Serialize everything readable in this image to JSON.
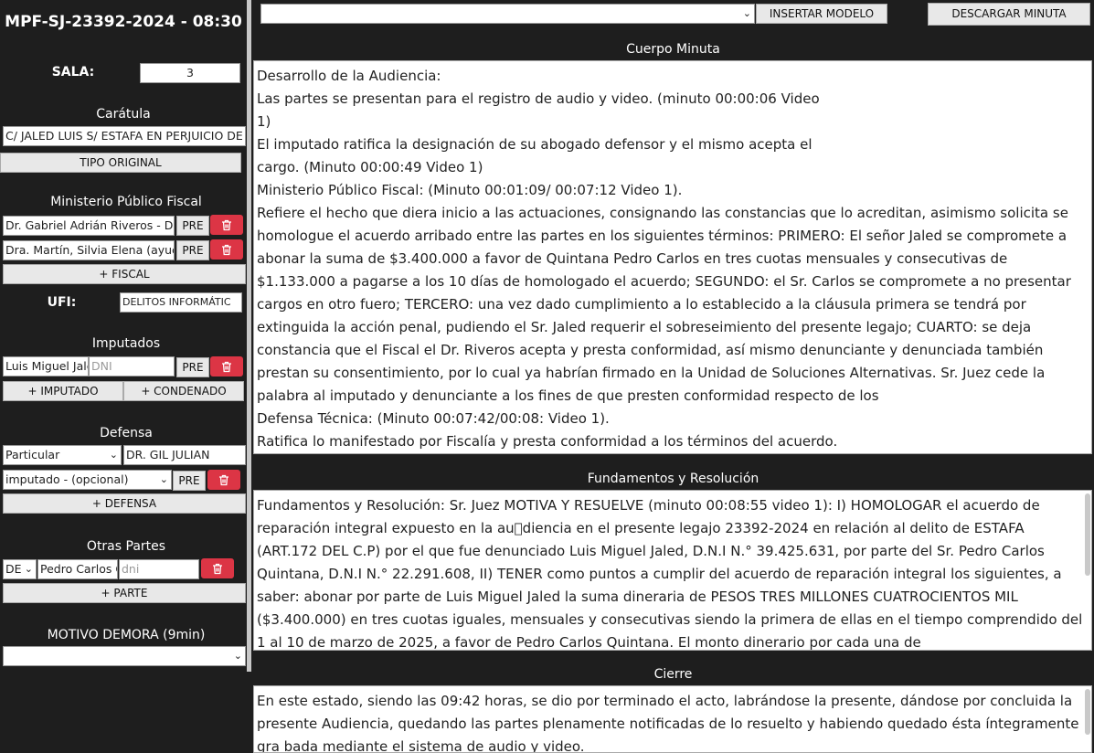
{
  "sidebar": {
    "case_title": "MPF-SJ-23392-2024 - 08:30",
    "sala_label": "SALA:",
    "sala_value": "3",
    "caratula_label": "Carátula",
    "caratula_value": "C/ JALED LUIS S/ ESTAFA EN PERJUICIO DE QU",
    "tipo_original_button": "TIPO ORIGINAL",
    "mpf_label": "Ministerio Público Fiscal",
    "fiscales": [
      {
        "name": "Dr. Gabriel Adrián Riveros - D",
        "pre": "PRE"
      },
      {
        "name": "Dra. Martín, Silvia Elena (ayuc",
        "pre": "PRE"
      }
    ],
    "add_fiscal_button": "+ FISCAL",
    "ufi_label": "UFI:",
    "ufi_value": "DELITOS INFORMÁTIC",
    "imputados_label": "Imputados",
    "imputado": {
      "name": "Luis Miguel Jaled",
      "dni_placeholder": "DNI",
      "pre": "PRE"
    },
    "add_imputado_button": "+ IMPUTADO",
    "add_condenado_button": "+ CONDENADO",
    "defensa_label": "Defensa",
    "defensa_tipo": "Particular",
    "defensa_nombre": "DR. GIL JULIAN",
    "defensa_imputado": "imputado - (opcional)",
    "defensa_pre": "PRE",
    "add_defensa_button": "+ DEFENSA",
    "otras_partes_label": "Otras Partes",
    "parte_tipo": "DE",
    "parte_nombre": "Pedro Carlos Q",
    "parte_dni_placeholder": "dni",
    "add_parte_button": "+ PARTE",
    "motivo_demora_label": "MOTIVO DEMORA (9min)",
    "motivo_demora_value": ""
  },
  "toolbar": {
    "model_select_value": "",
    "insert_model_button": "INSERTAR MODELO",
    "download_button": "DESCARGAR MINUTA"
  },
  "cuerpo": {
    "title": "Cuerpo Minuta",
    "text": "Desarrollo de la Audiencia:\nLas partes se presentan para el registro de audio y video. (minuto 00:00:06 Video\n1)\nEl imputado ratifica la designación de su abogado defensor y el mismo acepta el\ncargo. (Minuto 00:00:49 Video 1)\nMinisterio Público Fiscal: (Minuto 00:01:09/ 00:07:12 Video 1).\nRefiere el hecho que diera inicio a las actuaciones, consignando las constancias que lo acreditan, asimismo solicita se homologue el acuerdo arribado entre las partes en los siguientes términos: PRIMERO: El señor Jaled se compromete a abonar la suma de $3.400.000 a favor de Quintana Pedro Carlos en tres cuotas mensuales y consecutivas de $1.133.000 a pagarse a los 10 días de homologado el acuerdo; SEGUNDO: el Sr. Carlos se compromete a no presentar cargos en otro fuero; TERCERO: una vez dado cumplimiento a lo establecido a la cláusula primera se tendrá por extinguida la acción penal, pudiendo el Sr. Jaled requerir el sobreseimiento del presente legajo; CUARTO: se deja constancia que el Fiscal el Dr. Riveros acepta y presta conformidad, así mismo denunciante y denunciada también prestan su consentimiento, por lo cual ya habrían firmado en la Unidad de Soluciones Alternativas. Sr. Juez cede la palabra al imputado y denunciante a los fines de que presten conformidad respecto de los\nDefensa Técnica: (Minuto 00:07:42/00:08: Video 1).\nRatifica lo manifestado por Fiscalía y presta conformidad a los términos del acuerdo."
  },
  "fundamentos": {
    "title": "Fundamentos y Resolución",
    "text": "Fundamentos y Resolución: Sr. Juez MOTIVA Y RESUELVE (minuto 00:08:55 video 1): I) HOMOLOGAR el acuerdo de reparación integral expuesto en la au\u0000diencia en el presente legajo 23392-2024 en relación al delito de ESTAFA (ART.172 DEL C.P) por el que fue denunciado Luis Miguel Jaled, D.N.I N.° 39.425.631, por parte del Sr. Pedro Carlos Quintana, D.N.I N.° 22.291.608, II) TENER como puntos a cumplir del acuerdo de reparación integral los siguientes, a saber: abonar por parte de Luis Miguel Jaled la suma dineraria de PESOS TRES MILLONES CUATROCIENTOS MIL ($3.400.000) en tres cuotas iguales, mensuales y consecutivas siendo la primera de ellas en el tiempo comprendido del 1 al 10 de marzo de 2025, a favor de Pedro Carlos Quintana. El monto dinerario por cada una de"
  },
  "cierre": {
    "title": "Cierre",
    "text": "En este estado, siendo las 09:42 horas, se dio por terminado el acto, labrándose la presente, dándose por concluida la presente Audiencia, quedando las partes plenamente notificadas de lo resuelto y habiendo quedado ésta íntegramente gra bada mediante el sistema de audio y video."
  }
}
